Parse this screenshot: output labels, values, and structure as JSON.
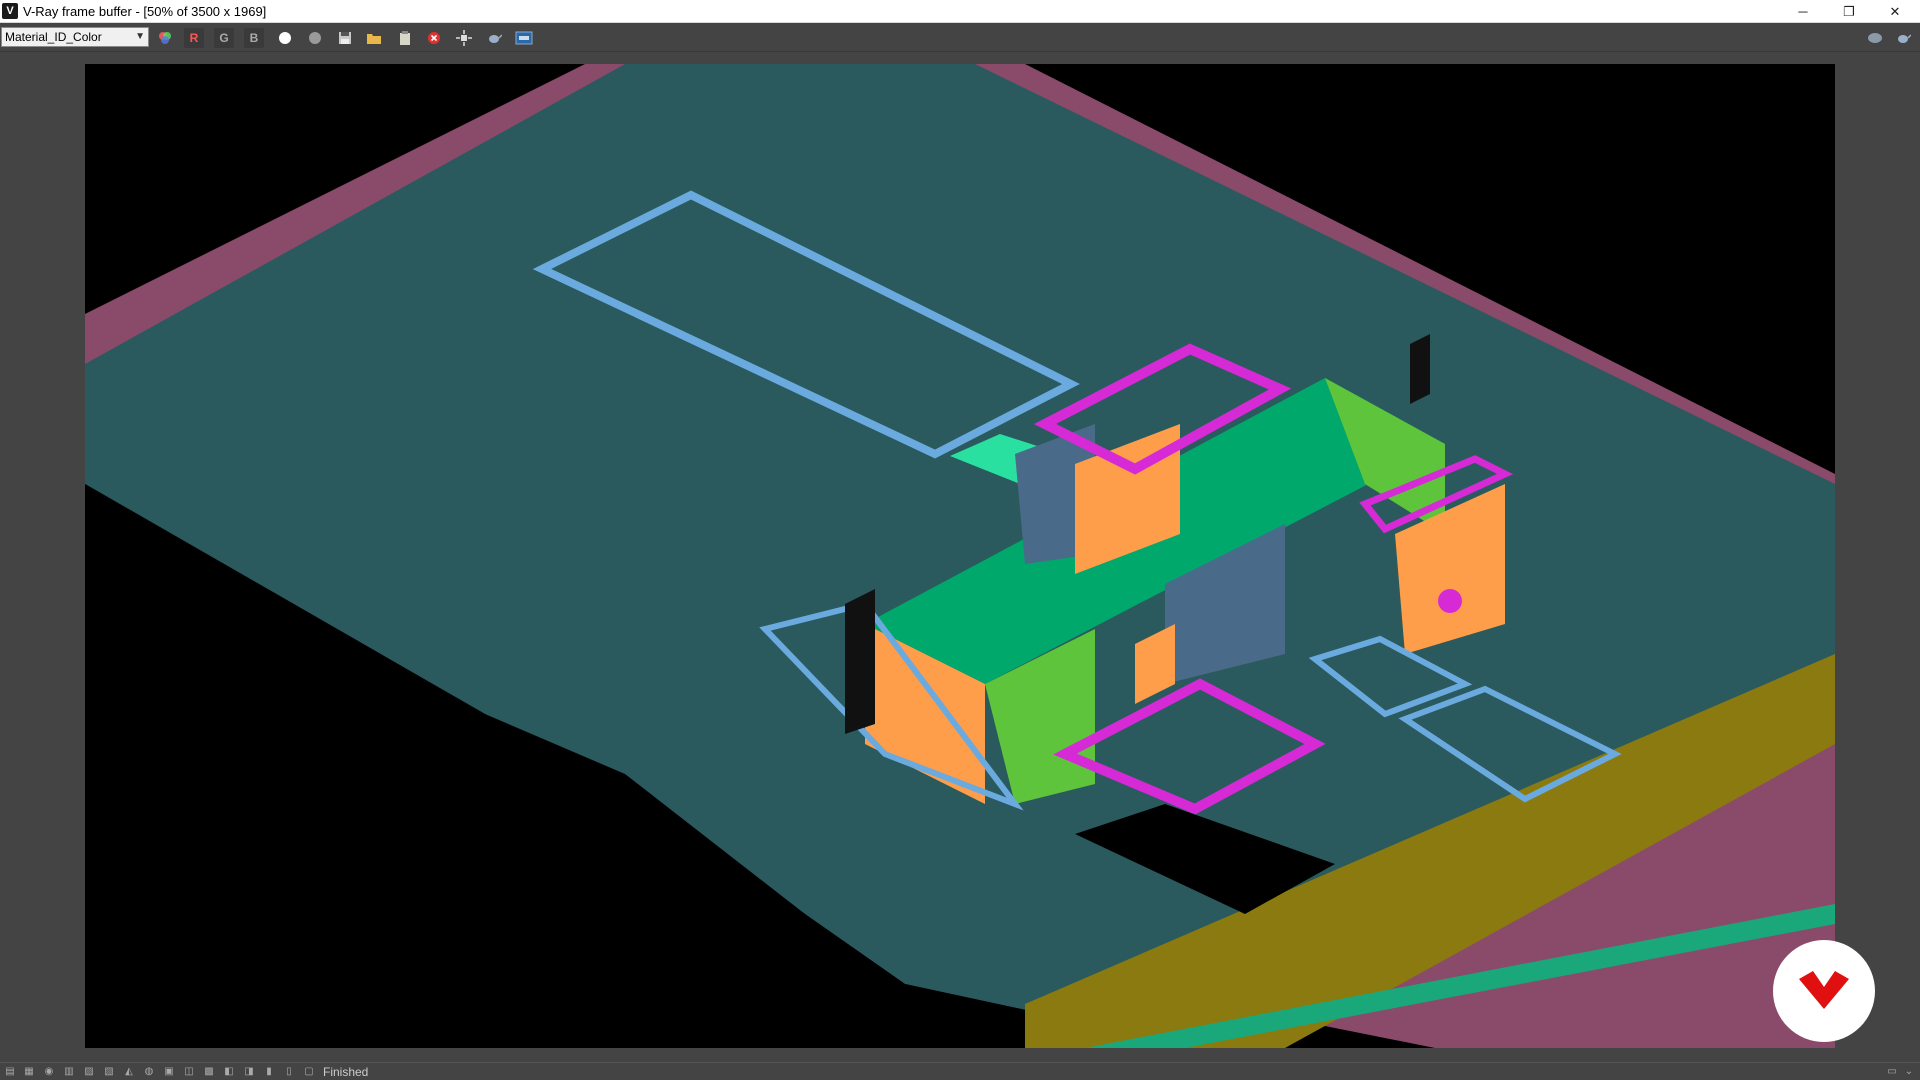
{
  "window": {
    "title": "V-Ray frame buffer - [50% of 3500 x 1969]",
    "app_icon": "V",
    "controls": {
      "minimize": "─",
      "restore": "❐",
      "close": "✕"
    }
  },
  "toolbar": {
    "channel": "Material_ID_Color",
    "red_label": "R",
    "green_label": "G",
    "blue_label": "B",
    "icons": [
      "color-channels-icon",
      "red-channel-button",
      "green-channel-button",
      "blue-channel-button",
      "white-dot-icon",
      "gray-dot-icon",
      "save-icon",
      "open-folder-icon",
      "clipboard-icon",
      "clear-icon",
      "region-render-icon",
      "teapot-icon",
      "track-mouse-icon",
      "lens-icon",
      "render-history-icon"
    ]
  },
  "status": {
    "text": "Finished"
  },
  "colors": {
    "background": "#444444",
    "ground": "#2a5a5e",
    "terrain": "#8a4a6a",
    "blue_outline": "#6aaadf",
    "green": "#00a86b",
    "light_green": "#5ec43c",
    "orange": "#ff9e4a",
    "magenta": "#d52ad5",
    "olive": "#8a7a10",
    "logo_red": "#e01010"
  }
}
